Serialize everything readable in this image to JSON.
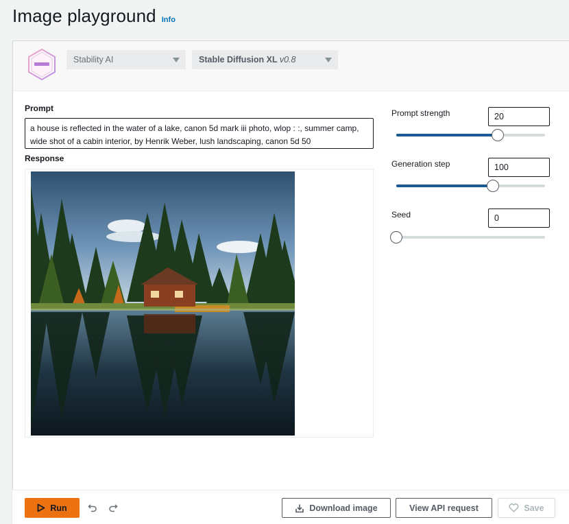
{
  "page": {
    "title": "Image playground",
    "info_link": "Info"
  },
  "model_selector": {
    "provider": "Stability AI",
    "model_name": "Stable Diffusion XL",
    "model_version": "v0.8"
  },
  "prompt": {
    "label": "Prompt",
    "value": "a house is reflected in the water of a lake, canon 5d mark iii photo, wlop : :, summer camp, wide shot of a cabin interior, by Henrik Weber, lush landscaping, canon 5d 50"
  },
  "response": {
    "label": "Response",
    "image_description": "A-frame cabin among pine trees reflected in a still lake"
  },
  "parameters": [
    {
      "label": "Prompt strength",
      "value": "20",
      "slider_fraction": 0.68
    },
    {
      "label": "Generation step",
      "value": "100",
      "slider_fraction": 0.65
    },
    {
      "label": "Seed",
      "value": "0",
      "slider_fraction": 0.0
    }
  ],
  "actions": {
    "run": "Run",
    "download": "Download image",
    "view_api": "View API request",
    "save": "Save"
  },
  "icons": {
    "run": "play-icon",
    "undo": "undo-icon",
    "redo": "redo-icon",
    "download": "download-icon",
    "save": "heart-icon",
    "dropdown": "caret-down-icon"
  },
  "colors": {
    "accent": "#ec7211",
    "link": "#0073bb",
    "slider_fill": "#1a5a96"
  }
}
